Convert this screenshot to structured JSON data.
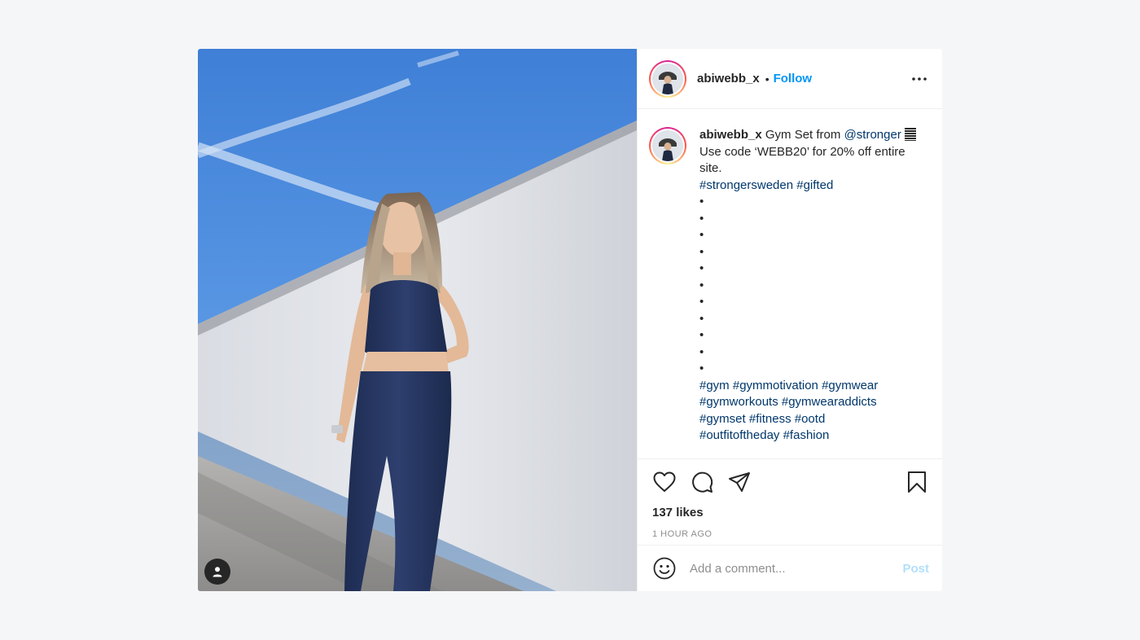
{
  "post": {
    "username": "abiwebb_x",
    "separator": "•",
    "follow_label": "Follow",
    "more_icon": "more-horizontal-icon",
    "tag_icon": "user-tag-icon",
    "caption": {
      "username": "abiwebb_x",
      "text_intro": "Gym Set from",
      "mention": "@stronger",
      "line2": "Use code ‘WEBB20’ for 20% off entire site.",
      "hashtags_line1": [
        "#strongersweden",
        "#gifted"
      ],
      "bullets": [
        "•",
        "•",
        "•",
        "•",
        "•",
        "•",
        "•",
        "•",
        "•",
        "•",
        "•"
      ],
      "hashtags_line2": [
        "#gym",
        "#gymmotivation",
        "#gymwear"
      ],
      "hashtags_line3": [
        "#gymworkouts",
        "#gymwearaddicts"
      ],
      "hashtags_line4": [
        "#gymset",
        "#fitness",
        "#ootd"
      ],
      "hashtags_line5": [
        "#outfitoftheday",
        "#fashion"
      ]
    },
    "likes": "137 likes",
    "time": "1 HOUR AGO",
    "icons": [
      "heart-icon",
      "comment-icon",
      "share-icon",
      "bookmark-icon",
      "emoji-icon"
    ]
  },
  "comment": {
    "placeholder": "Add a comment...",
    "post_label": "Post"
  },
  "colors": {
    "link_blue": "#0095f6",
    "hashtag": "#00376b",
    "post_disabled": "#b2dffc",
    "background": "#f5f6f8"
  }
}
